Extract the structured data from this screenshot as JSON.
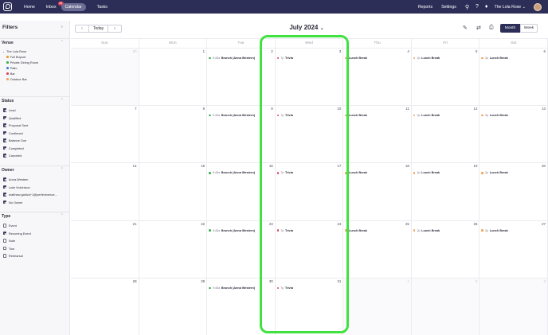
{
  "nav": {
    "home": "Home",
    "inbox": "Inbox",
    "inbox_badge": "18",
    "calendar": "Calendar",
    "tasks": "Tasks",
    "reports": "Reports",
    "settings": "Settings",
    "venue": "The Lola Rose"
  },
  "sidebar": {
    "title": "Filters",
    "venue": {
      "heading": "Venue",
      "parent": "The Lola Rose",
      "items": [
        {
          "label": "Full Buyout",
          "color": "#e89a2a"
        },
        {
          "label": "Private Dining Room",
          "color": "#3fae4e"
        },
        {
          "label": "Patio",
          "color": "#3b82d6"
        },
        {
          "label": "Bar",
          "color": "#e0435a"
        },
        {
          "label": "Outdoor Bar",
          "color": "#f2a154"
        }
      ]
    },
    "status": {
      "heading": "Status",
      "items": [
        "Lead",
        "Qualified",
        "Proposal Sent",
        "Confirmed",
        "Balance Due",
        "Completed",
        "Canceled"
      ]
    },
    "owner": {
      "heading": "Owner",
      "items": [
        "Anna Western",
        "Luke Hutchison",
        "matthew.garlick+1@perfectvenue...",
        "No Owner"
      ]
    },
    "type": {
      "heading": "Type",
      "items": [
        {
          "label": "Event",
          "checked": false
        },
        {
          "label": "Recurring Event",
          "checked": true
        },
        {
          "label": "Note",
          "checked": false
        },
        {
          "label": "Tour",
          "checked": false
        },
        {
          "label": "Rehearsal",
          "checked": false
        }
      ]
    }
  },
  "toolbar": {
    "prev": "‹",
    "today": "Today",
    "next": "›",
    "month_title": "July 2024",
    "view_month": "Month",
    "view_week": "Week"
  },
  "calendar": {
    "days_of_week": [
      "Sun",
      "Mon",
      "Tue",
      "Wed",
      "Thu",
      "Fri",
      "Sat"
    ],
    "weeks": [
      [
        {
          "n": "30",
          "out": true
        },
        {
          "n": "1"
        },
        {
          "n": "2"
        },
        {
          "n": "3"
        },
        {
          "n": "4"
        },
        {
          "n": "5"
        },
        {
          "n": "6"
        }
      ],
      [
        {
          "n": "7"
        },
        {
          "n": "8"
        },
        {
          "n": "9"
        },
        {
          "n": "10"
        },
        {
          "n": "11"
        },
        {
          "n": "12"
        },
        {
          "n": "13"
        }
      ],
      [
        {
          "n": "14"
        },
        {
          "n": "15"
        },
        {
          "n": "16"
        },
        {
          "n": "17"
        },
        {
          "n": "18"
        },
        {
          "n": "19"
        },
        {
          "n": "20"
        }
      ],
      [
        {
          "n": "21"
        },
        {
          "n": "22"
        },
        {
          "n": "23"
        },
        {
          "n": "24"
        },
        {
          "n": "25"
        },
        {
          "n": "26"
        },
        {
          "n": "27"
        }
      ],
      [
        {
          "n": "28"
        },
        {
          "n": "29"
        },
        {
          "n": "30"
        },
        {
          "n": "31"
        },
        {
          "n": "1",
          "out": true
        },
        {
          "n": "2",
          "out": true
        },
        {
          "n": "3",
          "out": true
        }
      ]
    ],
    "events": {
      "tue": {
        "time": "9:45a",
        "title": "Brunch (Anna Western)",
        "color": "#3fae4e"
      },
      "wed": {
        "time": "7p",
        "title": "Trivia",
        "color": "#e0435a"
      },
      "thu": {
        "time": "",
        "title": "Lunch Break",
        "color": "#f2a154"
      },
      "fri": {
        "time": "2p",
        "title": "Lunch Break",
        "color": "#f2a154"
      },
      "sat": {
        "time": "2p",
        "title": "Lunch Break",
        "color": "#f2a154"
      }
    }
  }
}
